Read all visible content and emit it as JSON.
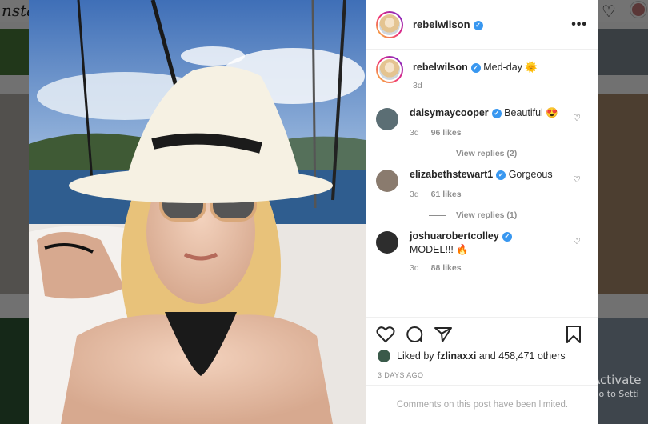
{
  "background": {
    "logo_text": "nstag"
  },
  "post": {
    "author": "rebelwilson",
    "caption_user": "rebelwilson",
    "caption_text": "Med-day 🌞",
    "caption_age": "3d",
    "likes_prefix": "Liked by",
    "liked_by_user": "fzlinaxxi",
    "likes_suffix": "and 458,471 others",
    "date": "3 DAYS AGO",
    "comments_limited": "Comments on this post have been limited."
  },
  "comments": [
    {
      "user": "daisymaycooper",
      "text": "Beautiful 😍",
      "age": "3d",
      "likes": "96 likes",
      "replies": "View replies (2)",
      "avatar_color": "#5b6e74"
    },
    {
      "user": "elizabethstewart1",
      "text": "Gorgeous",
      "age": "3d",
      "likes": "61 likes",
      "replies": "View replies (1)",
      "avatar_color": "#8a7b6e"
    },
    {
      "user": "joshuarobertcolley",
      "text": "MODEL!!! 🔥",
      "age": "3d",
      "likes": "88 likes",
      "avatar_color": "#2d2d2d"
    }
  ],
  "watermark": {
    "line1": "Activate",
    "line2": "Go to Setti"
  },
  "icons": {
    "more": "more-options-icon",
    "verified": "verified-badge-icon",
    "like": "heart-icon",
    "comment": "comment-icon",
    "share": "share-icon",
    "save": "bookmark-icon"
  }
}
